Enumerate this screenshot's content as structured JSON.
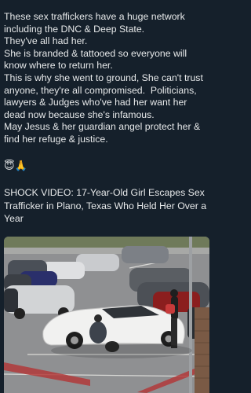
{
  "post": {
    "text": "These sex traffickers have a huge network including the DNC & Deep State.\nThey've all had her.\nShe is branded & tattooed so everyone will know where to return her.\nThis is why she went to ground, She can't trust anyone, they're all compromised.  Politicians, lawyers & Judges who've had her want her dead now because she's infamous.\nMay Jesus & her guardian angel protect her & find her refuge & justice.",
    "emojis": "😇🙏"
  },
  "link_card": {
    "title": "SHOCK VIDEO: 17-Year-Old Girl Escapes Sex Trafficker in Plano, Texas Who Held Her Over a Year"
  },
  "colors": {
    "background": "#15202b",
    "text": "#e7e9ea"
  }
}
